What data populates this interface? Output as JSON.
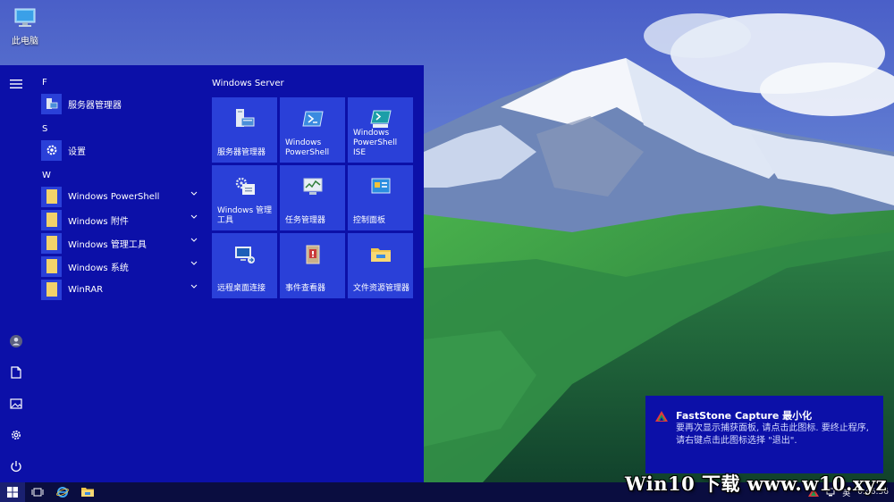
{
  "desktop": {
    "icon_label": "此电脑"
  },
  "start_menu": {
    "groups": [
      {
        "letter": "F",
        "items": [
          {
            "label": "服务器管理器",
            "icon": "server-manager-icon",
            "expandable": false
          }
        ]
      },
      {
        "letter": "S",
        "items": [
          {
            "label": "设置",
            "icon": "gear-icon",
            "expandable": false
          }
        ]
      },
      {
        "letter": "W",
        "items": [
          {
            "label": "Windows PowerShell",
            "icon": "folder-icon",
            "expandable": true
          },
          {
            "label": "Windows 附件",
            "icon": "folder-icon",
            "expandable": true
          },
          {
            "label": "Windows 管理工具",
            "icon": "folder-icon",
            "expandable": true
          },
          {
            "label": "Windows 系统",
            "icon": "folder-icon",
            "expandable": true
          },
          {
            "label": "WinRAR",
            "icon": "folder-icon",
            "expandable": true
          }
        ]
      }
    ],
    "rail": [
      "user-icon",
      "document-icon",
      "pictures-icon",
      "gear-icon",
      "power-icon"
    ],
    "tiles_header": "Windows Server",
    "tiles": [
      {
        "label": "服务器管理器",
        "icon": "server-manager-icon"
      },
      {
        "label": "Windows PowerShell",
        "icon": "powershell-icon"
      },
      {
        "label": "Windows PowerShell ISE",
        "icon": "powershell-ise-icon"
      },
      {
        "label": "Windows 管理工具",
        "icon": "admin-tools-icon"
      },
      {
        "label": "任务管理器",
        "icon": "task-manager-icon"
      },
      {
        "label": "控制面板",
        "icon": "control-panel-icon"
      },
      {
        "label": "远程桌面连接",
        "icon": "remote-desktop-icon"
      },
      {
        "label": "事件查看器",
        "icon": "event-viewer-icon"
      },
      {
        "label": "文件资源管理器",
        "icon": "file-explorer-icon"
      }
    ]
  },
  "toast": {
    "title": "FastStone Capture 最小化",
    "body": "要再次显示捕获面板, 请点击此图标. 要终止程序, 请右键点击此图标选择 \"退出\"."
  },
  "taskbar": {
    "tray_lang": "英",
    "clock": "0:46:36"
  },
  "watermark": "Win10 下载 www.w10.xyz",
  "colors": {
    "start_bg": "#0c10a8",
    "tile_bg": "#2a40d8",
    "taskbar_bg": "#0a0d40"
  }
}
